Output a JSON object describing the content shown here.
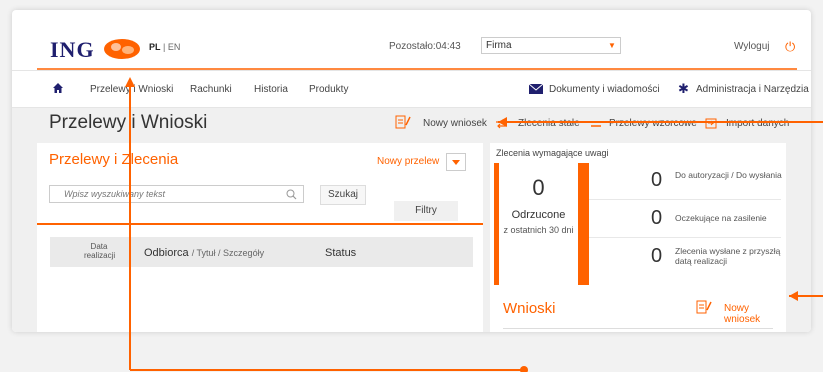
{
  "header": {
    "logo": "ING",
    "lang_pl": "PL",
    "lang_sep": "|",
    "lang_en": "EN",
    "timer": "Pozostało:04:43",
    "profile": "Firma",
    "logout": "Wyloguj"
  },
  "nav": {
    "items": [
      "Przelewy i Wnioski",
      "Rachunki",
      "Historia",
      "Produkty"
    ],
    "documents": "Dokumenty i wiadomości",
    "admin": "Administracja i Narzędzia"
  },
  "page": {
    "title": "Przelewy i Wnioski",
    "actions": [
      "Nowy wniosek",
      "Zlecenia stałe",
      "Przelewy wzorcowe",
      "Import danych"
    ]
  },
  "transfers": {
    "title": "Przelewy i Zlecenia",
    "new_transfer": "Nowy przelew",
    "search_placeholder": "Wpisz wyszukiwany tekst",
    "search_button": "Szukaj",
    "filters_button": "Filtry",
    "columns": {
      "date": "Data realizacji",
      "recipient": "Odbiorca",
      "recipient_sub": "/ Tytuł / Szczegóły",
      "status": "Status"
    }
  },
  "attention": {
    "title": "Zlecenia wymagające uwagi",
    "rejected_count": "0",
    "rejected_label": "Odrzucone",
    "rejected_sub": "z ostatnich 30 dni",
    "rows": [
      {
        "count": "0",
        "label": "Do autoryzacji / Do wysłania"
      },
      {
        "count": "0",
        "label": "Oczekujące na zasilenie"
      },
      {
        "count": "0",
        "label": "Zlecenia wysłane z przyszłą datą realizacji"
      }
    ]
  },
  "requests": {
    "title": "Wnioski",
    "new_request": "Nowy wniosek"
  },
  "colors": {
    "accent": "#ff6200",
    "navy": "#1f1f6e"
  }
}
